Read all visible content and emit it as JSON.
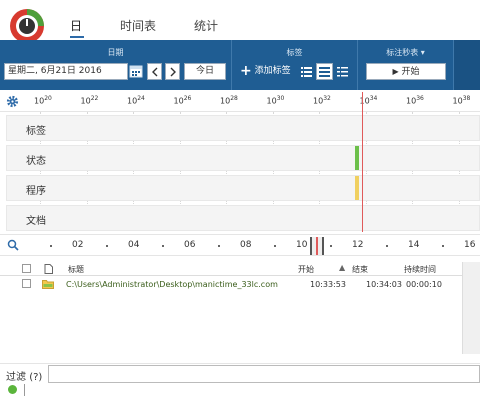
{
  "tabs": [
    {
      "label": "日",
      "active": true
    },
    {
      "label": "时间表",
      "active": false
    },
    {
      "label": "统计",
      "active": false
    }
  ],
  "ribbon": {
    "date_section_title": "日期",
    "date_value": "星期二, 6月21日 2016",
    "today_label": "今日",
    "tags_section_title": "标签",
    "add_tag_label": "添加标签",
    "stopwatch_section_title": "标注秒表",
    "start_label": "开始"
  },
  "timeline": {
    "ticks": [
      {
        "hour": "10",
        "min": "20"
      },
      {
        "hour": "10",
        "min": "22"
      },
      {
        "hour": "10",
        "min": "24"
      },
      {
        "hour": "10",
        "min": "26"
      },
      {
        "hour": "10",
        "min": "28"
      },
      {
        "hour": "10",
        "min": "30"
      },
      {
        "hour": "10",
        "min": "32"
      },
      {
        "hour": "10",
        "min": "34"
      },
      {
        "hour": "10",
        "min": "36"
      },
      {
        "hour": "10",
        "min": "38"
      }
    ]
  },
  "rows": [
    {
      "label": "标签"
    },
    {
      "label": "状态"
    },
    {
      "label": "程序"
    },
    {
      "label": "文档"
    }
  ],
  "overview": {
    "ticks": [
      "02",
      "04",
      "06",
      "08",
      "10",
      "12",
      "14",
      "16"
    ]
  },
  "table": {
    "headers": {
      "title": "标题",
      "start": "开始",
      "end": "结束",
      "duration": "持续时间"
    },
    "rows": [
      {
        "title": "C:\\Users\\Administrator\\Desktop\\manictime_33lc.com",
        "start": "10:33:53",
        "end": "10:34:03",
        "duration": "00:00:10"
      }
    ]
  },
  "filter": {
    "label": "过滤",
    "help": "(?)",
    "value": ""
  },
  "colors": {
    "ribbon": "#1f5d93",
    "status_green": "#6cc04a",
    "program_yellow": "#f0d060",
    "cursor_red": "#e05a5a"
  }
}
